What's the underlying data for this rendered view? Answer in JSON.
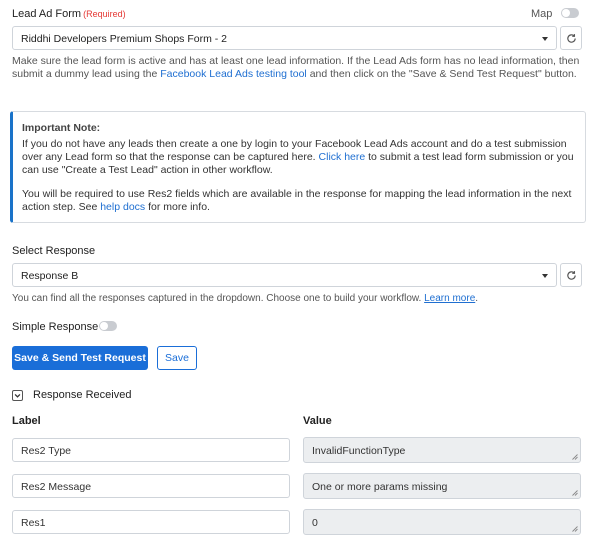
{
  "lead_ad_form": {
    "label": "Lead Ad Form",
    "required": "(Required)",
    "map_label": "Map",
    "selected": "Riddhi Developers Premium Shops Form - 2",
    "help_part1": "Make sure the lead form is active and has at least one lead information. If the Lead Ads form has no lead information, then submit a dummy lead using the ",
    "help_link": "Facebook Lead Ads testing tool",
    "help_part2": " and then click on the \"Save & Send Test Request\" button."
  },
  "important_note": {
    "title": "Important Note:",
    "para1_part1": "If you do not have any leads then create a one by login to your Facebook Lead Ads account and do a test submission over any Lead form so that the response can be captured here. ",
    "para1_link": "Click here",
    "para1_part2": " to submit a test lead form submission or you can use \"Create a Test Lead\" action in other workflow.",
    "para2_part1": "You will be required to use Res2 fields which are available in the response for mapping the lead information in the next action step. See ",
    "para2_link": "help docs",
    "para2_part2": " for more info."
  },
  "select_response": {
    "label": "Select Response",
    "selected": "Response B",
    "help_text": "You can find all the responses captured in the dropdown. Choose one to build your workflow. ",
    "help_link": "Learn more",
    "help_end": "."
  },
  "simple_response": {
    "label": "Simple Response"
  },
  "buttons": {
    "save_send": "Save & Send Test Request",
    "save": "Save"
  },
  "response_received": {
    "label": "Response Received",
    "col_label": "Label",
    "col_value": "Value",
    "rows": [
      {
        "label": "Res2 Type",
        "value": "InvalidFunctionType"
      },
      {
        "label": "Res2 Message",
        "value": "One or more params missing"
      },
      {
        "label": "Res1",
        "value": "0"
      }
    ]
  },
  "colors": {
    "accent": "#1a6ed8",
    "required": "#e53935",
    "note_border": "#1a73c9",
    "value_bg": "#eceef0"
  },
  "icons": [
    "refresh-icon",
    "chevron-down-icon",
    "checkbox-checked-icon",
    "resize-grip-icon"
  ]
}
